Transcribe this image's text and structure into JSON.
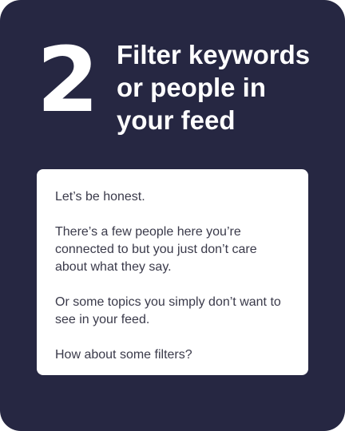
{
  "card": {
    "step_number": "2",
    "title_lines": [
      "Filter keywords",
      "or people in",
      "your feed"
    ],
    "paragraphs": [
      "Let’s be honest.",
      "There’s a few people here you’re connected to but you just don’t care about what they say.",
      "Or some topics you simply don’t want to see in your feed.",
      "How about some filters?"
    ]
  },
  "colors": {
    "card_background": "#262742",
    "panel_background": "#ffffff",
    "title_text": "#ffffff",
    "body_text": "#3a3a4a"
  }
}
